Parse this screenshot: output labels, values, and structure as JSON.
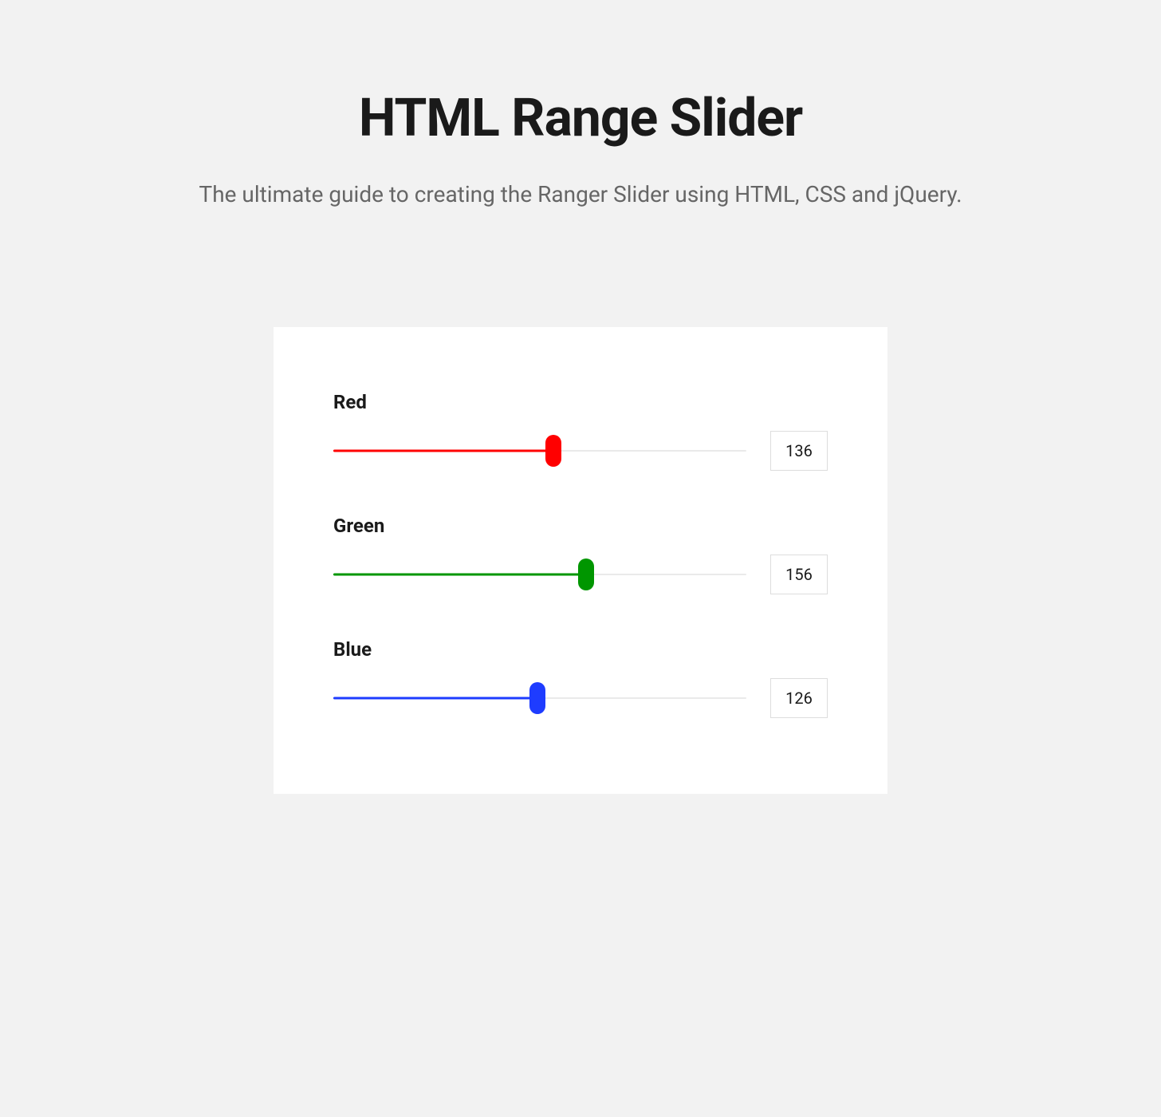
{
  "header": {
    "title": "HTML Range Slider",
    "subtitle": "The ultimate guide to creating the Ranger Slider using HTML, CSS and jQuery."
  },
  "sliders": {
    "max": 255,
    "red": {
      "label": "Red",
      "value": 136,
      "color": "#ff0000"
    },
    "green": {
      "label": "Green",
      "value": 156,
      "color": "#009600"
    },
    "blue": {
      "label": "Blue",
      "value": 126,
      "color": "#1e3cff"
    }
  }
}
